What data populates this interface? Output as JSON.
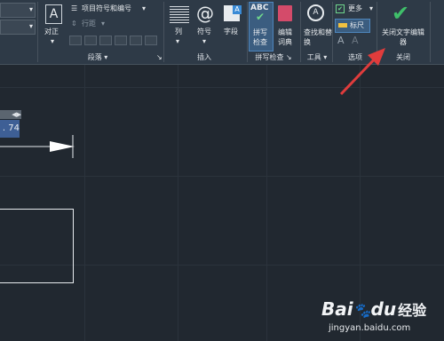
{
  "ribbon": {
    "justify_label": "对正",
    "bullets_label": "项目符号和编号",
    "line_spacing_label": "行距",
    "paragraph_group": "段落",
    "insert": {
      "column": "列",
      "symbol": "符号",
      "field": "字段",
      "group": "插入"
    },
    "spell": {
      "check": "拼写检查",
      "edit_dict": "编辑词典",
      "group": "拼写检查",
      "abc": "ABC"
    },
    "tools": {
      "find_replace": "查找和替换",
      "group": "工具"
    },
    "options": {
      "more": "更多",
      "ruler": "标尺",
      "group": "选项"
    },
    "close": {
      "label": "关闭文字编辑器",
      "group": "关闭"
    }
  },
  "canvas": {
    "ruler_value": ". 74"
  },
  "watermark": {
    "brand_bai": "Bai",
    "brand_du": "du",
    "brand_cn": "经验",
    "url": "jingyan.baidu.com"
  },
  "colors": {
    "ribbon_bg": "#2e3a47",
    "canvas_bg": "#212830",
    "close_check": "#3fbf6a",
    "annotation_arrow": "#e03c3c"
  }
}
